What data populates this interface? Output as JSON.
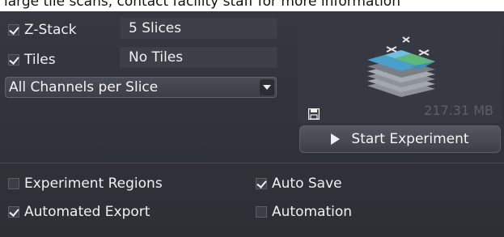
{
  "banner": {
    "text": "large tile scans, contact facility staff for more information"
  },
  "acquisition": {
    "zstack": {
      "label": "Z-Stack",
      "checked": true,
      "value": "5 Slices"
    },
    "tiles": {
      "label": "Tiles",
      "checked": true,
      "value": "No Tiles"
    },
    "channel_mode": {
      "selected": "All Channels per Slice"
    }
  },
  "preview": {
    "size": "217.31 MB",
    "icons": {
      "stack": "stack-icon",
      "save": "save-icon"
    }
  },
  "start_button": {
    "label": "Start Experiment"
  },
  "options": {
    "experiment_regions": {
      "label": "Experiment Regions",
      "checked": false
    },
    "auto_save": {
      "label": "Auto Save",
      "checked": true
    },
    "automated_export": {
      "label": "Automated Export",
      "checked": true
    },
    "automation": {
      "label": "Automation",
      "checked": false
    }
  },
  "colors": {
    "panel_bg": "#2f3138",
    "field_bg": "#3d4049",
    "text": "#f1f1f3",
    "muted_text": "#5c606a"
  }
}
